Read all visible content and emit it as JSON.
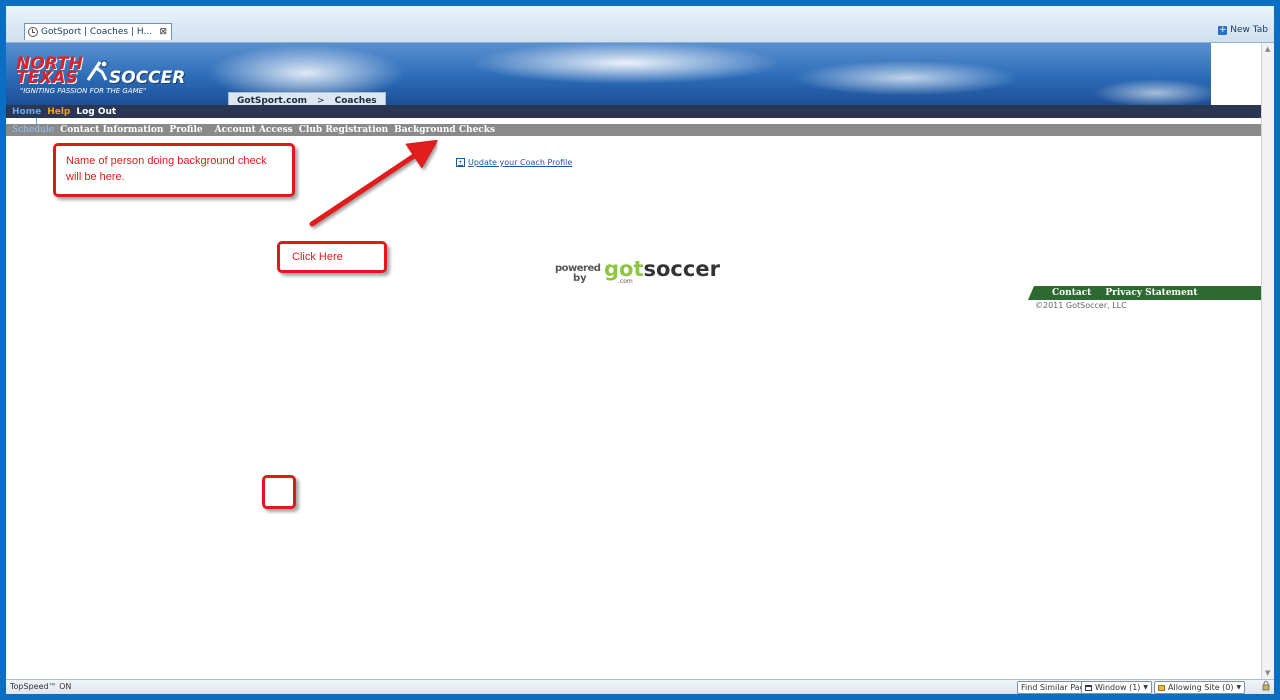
{
  "browser": {
    "tab_title": "GotSport | Coaches | H...",
    "tab_close": "⊠",
    "new_tab_label": "New Tab"
  },
  "banner": {
    "logo_line1": "NORTH",
    "logo_line2": "TEXAS",
    "logo_line3": "SOCCER",
    "tagline": "\"IGNITING PASSION FOR THE GAME\"",
    "breadcrumb": {
      "site": "GotSport.com",
      "separator": ">",
      "section": "Coaches"
    }
  },
  "nav": {
    "home": "Home",
    "help": "Help",
    "logout": "Log Out",
    "home_color": "#62a9ee",
    "help_color": "#f0a21a"
  },
  "subnav": {
    "items": [
      "Schedule",
      "Contact Information",
      "Profile",
      "Account Access",
      "Club Registration",
      "Background Checks"
    ],
    "active_color": "#8fc5f5"
  },
  "content": {
    "update_link": "Update your Coach Profile"
  },
  "annotations": {
    "callout_text": "Name of person doing background check will  be here.",
    "click_here": "Click Here",
    "color": "#e01a1a"
  },
  "powered": {
    "word": "powered",
    "by": "by",
    "brand_light": "got",
    "brand_dark": "soccer",
    "com": ".com"
  },
  "footer": {
    "contact": "Contact",
    "privacy": "Privacy Statement",
    "copyright": "©2011 GotSoccer, LLC"
  },
  "statusbar": {
    "speed": "TopSpeed™ ON",
    "find_similar": "Find Similar Pages",
    "window": "Window (1)",
    "allowing": "Allowing Site (0)"
  }
}
